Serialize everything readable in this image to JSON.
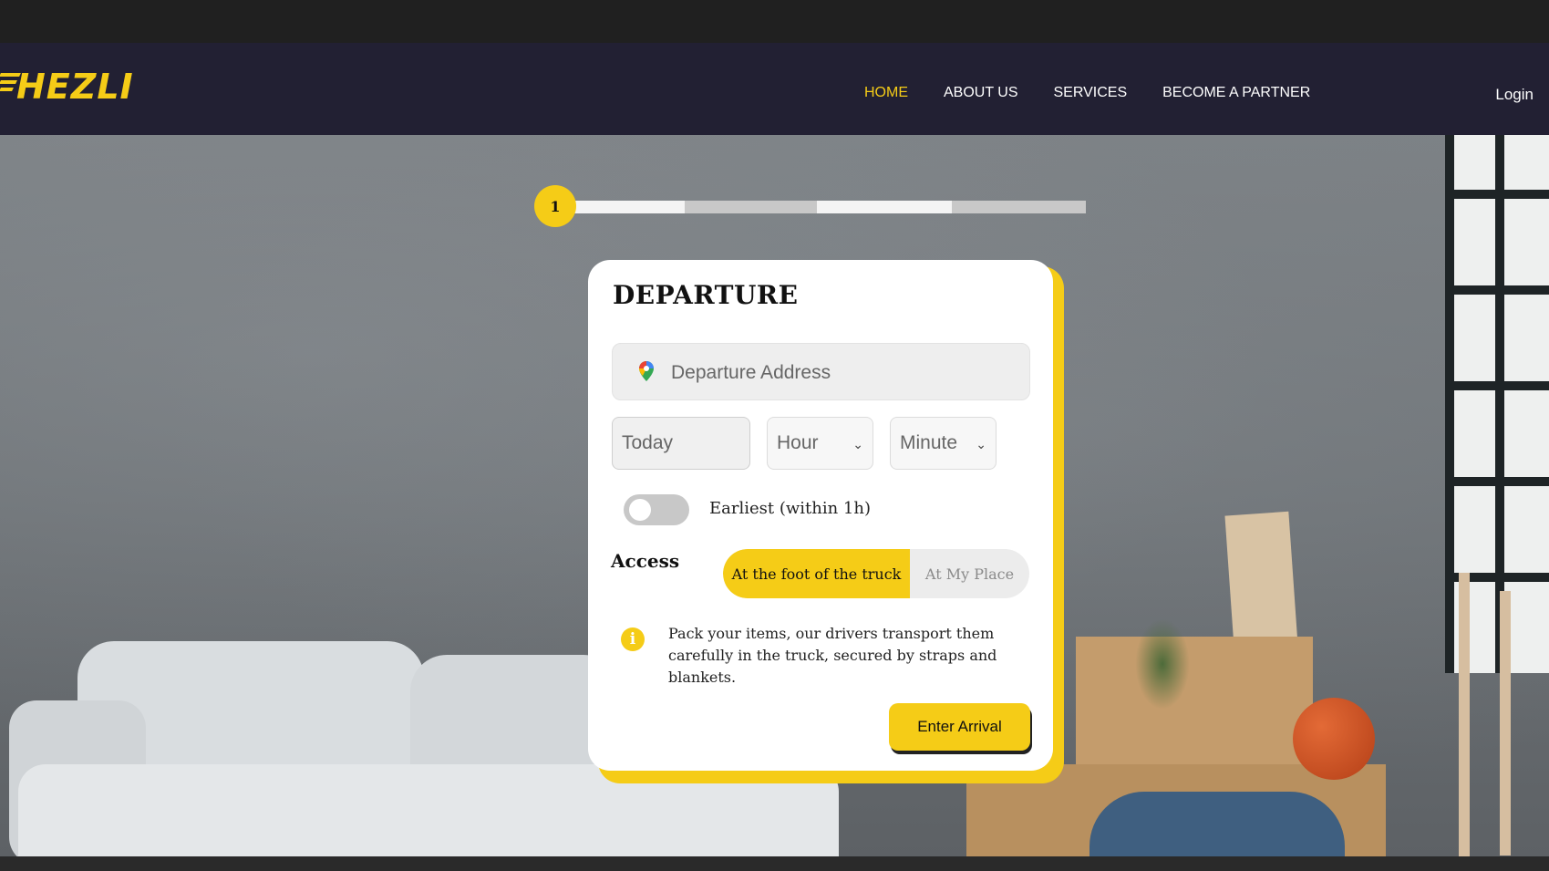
{
  "brand": {
    "logo_text": "HEZLI",
    "accent": "#f5cc17",
    "nav_bg": "#222033"
  },
  "nav": {
    "items": [
      {
        "label": "HOME",
        "active": true
      },
      {
        "label": "ABOUT US",
        "active": false
      },
      {
        "label": "SERVICES",
        "active": false
      },
      {
        "label": "BECOME A PARTNER",
        "active": false
      }
    ],
    "login": "Login"
  },
  "progress": {
    "current_step": "1",
    "segments": [
      "complete",
      "pending",
      "complete",
      "pending"
    ]
  },
  "form": {
    "title": "DEPARTURE",
    "address_placeholder": "Departure Address",
    "address_icon": "map-pin-icon",
    "date_value": "Today",
    "hour_placeholder": "Hour",
    "minute_placeholder": "Minute",
    "toggle_label": "Earliest (within 1h)",
    "toggle_on": false,
    "access_label": "Access",
    "access_options": [
      {
        "label": "At the foot of the truck",
        "selected": true
      },
      {
        "label": "At My Place",
        "selected": false
      }
    ],
    "info_icon": "info-icon",
    "info_text": "Pack your items, our drivers transport them carefully in the truck, secured by straps and blankets.",
    "submit_label": "Enter Arrival"
  }
}
